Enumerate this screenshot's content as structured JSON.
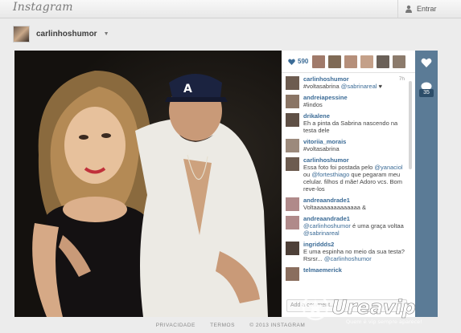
{
  "header": {
    "logo": "Instagram",
    "login_label": "Entrar"
  },
  "profile": {
    "username": "carlinhoshumor"
  },
  "likes": {
    "count": "590",
    "liker_colors": [
      "#a07a6a",
      "#7f6a55",
      "#b58f7a",
      "#c4a089",
      "#6a6058",
      "#8c7b6c",
      "#5a4f48"
    ]
  },
  "comments": [
    {
      "user": "carlinhoshumor",
      "time": "7h",
      "text": "#voltasabrina @sabrinareal ♥",
      "avatar": "#6d5c50"
    },
    {
      "user": "andreiapessine",
      "time": "",
      "text": "#lindos",
      "avatar": "#8a7565"
    },
    {
      "user": "drikalene",
      "time": "",
      "text": "Eh a pinta da Sabrina nascendo na testa dele",
      "avatar": "#5f5046"
    },
    {
      "user": "vitoriia_morais",
      "time": "",
      "text": "#voltasabrina",
      "avatar": "#9c8a7c"
    },
    {
      "user": "carlinhoshumor",
      "time": "",
      "text": "Essa foto foi postada pelo @yanaciol ou @fortesthiago que pegaram meu celular. filhos d mãe! Adoro vcs. Bom reve-los",
      "avatar": "#6d5c50"
    },
    {
      "user": "andreaandrade1",
      "time": "",
      "text": "Voltaaaaaaaaaaaaaa &",
      "avatar": "#b08a8a"
    },
    {
      "user": "andreaandrade1",
      "time": "",
      "text": "@carlinhoshumor é uma graça voltaa @sabrinareal",
      "avatar": "#b08a8a"
    },
    {
      "user": "ingriddds2",
      "time": "",
      "text": "E uma espinha no meio da sua testa? Rsrsr... @carlinhoshumor",
      "avatar": "#4e4038"
    },
    {
      "user": "telmaemerick",
      "time": "",
      "text": "",
      "avatar": "#8a6e5e"
    }
  ],
  "comment_placeholder": "Add a comment...",
  "actions": {
    "comment_count": "35"
  },
  "footer": {
    "privacy": "PRIVACIDADE",
    "terms": "TERMOS",
    "copyright": "© 2013 INSTAGRAM"
  },
  "watermark": {
    "brand": "Ureavip",
    "tagline": "Quem é vip sempre aparece!"
  },
  "colors": {
    "action_bar": "#5b7b96",
    "link": "#3b6b96",
    "heart": "#3b6b96"
  }
}
